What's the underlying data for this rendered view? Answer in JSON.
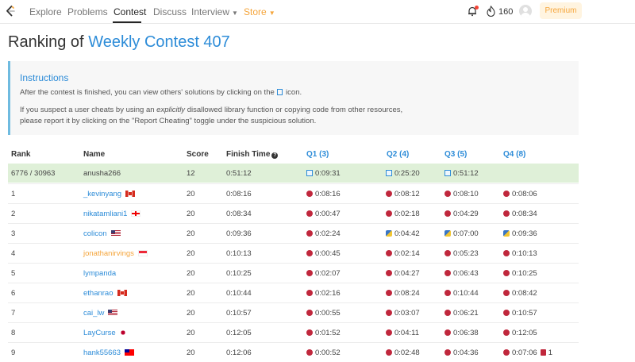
{
  "nav": {
    "items": [
      "Explore",
      "Problems",
      "Contest",
      "Discuss",
      "Interview",
      "Store"
    ],
    "coins": "160",
    "premium": "Premium"
  },
  "page": {
    "title_prefix": "Ranking of",
    "title_link": "Weekly Contest 407"
  },
  "instructions": {
    "title": "Instructions",
    "line1_a": "After the contest is finished, you can view others' solutions by clicking on the",
    "line1_b": "icon.",
    "line2_a": "If you suspect a user cheats by using an",
    "line2_em": "explicitly",
    "line2_b": "disallowed library function or copying code from other resources,",
    "line3": "please report it by clicking on the \"Report Cheating\" toggle under the suspicious solution."
  },
  "table": {
    "headers": [
      "Rank",
      "Name",
      "Score",
      "Finish Time",
      "Q1 (3)",
      "Q2 (4)",
      "Q3 (5)",
      "Q4 (8)"
    ],
    "rows": [
      {
        "rank": "6776 / 30963",
        "name": "anusha266",
        "score": "12",
        "finish": "0:51:12",
        "q1": "0:09:31",
        "q2": "0:25:20",
        "q3": "0:51:12",
        "q4": ""
      },
      {
        "rank": "1",
        "name": "_kevinyang",
        "score": "20",
        "finish": "0:08:16",
        "q1": "0:08:16",
        "q2": "0:08:12",
        "q3": "0:08:10",
        "q4": "0:08:06"
      },
      {
        "rank": "2",
        "name": "nikatamliani1",
        "score": "20",
        "finish": "0:08:34",
        "q1": "0:00:47",
        "q2": "0:02:18",
        "q3": "0:04:29",
        "q4": "0:08:34"
      },
      {
        "rank": "3",
        "name": "colicon",
        "score": "20",
        "finish": "0:09:36",
        "q1": "0:02:24",
        "q2": "0:04:42",
        "q3": "0:07:00",
        "q4": "0:09:36"
      },
      {
        "rank": "4",
        "name": "jonathanirvings",
        "score": "20",
        "finish": "0:10:13",
        "q1": "0:00:45",
        "q2": "0:02:14",
        "q3": "0:05:23",
        "q4": "0:10:13"
      },
      {
        "rank": "5",
        "name": "lympanda",
        "score": "20",
        "finish": "0:10:25",
        "q1": "0:02:07",
        "q2": "0:04:27",
        "q3": "0:06:43",
        "q4": "0:10:25"
      },
      {
        "rank": "6",
        "name": "ethanrao",
        "score": "20",
        "finish": "0:10:44",
        "q1": "0:02:16",
        "q2": "0:08:24",
        "q3": "0:10:44",
        "q4": "0:08:42"
      },
      {
        "rank": "7",
        "name": "cai_lw",
        "score": "20",
        "finish": "0:10:57",
        "q1": "0:00:55",
        "q2": "0:03:07",
        "q3": "0:06:21",
        "q4": "0:10:57"
      },
      {
        "rank": "8",
        "name": "LayCurse",
        "score": "20",
        "finish": "0:12:05",
        "q1": "0:01:52",
        "q2": "0:04:11",
        "q3": "0:06:38",
        "q4": "0:12:05"
      },
      {
        "rank": "9",
        "name": "hank55663",
        "score": "20",
        "finish": "0:12:06",
        "q1": "0:00:52",
        "q2": "0:02:48",
        "q3": "0:04:36",
        "q4": "0:07:06",
        "q4_penalty": "1"
      }
    ]
  }
}
